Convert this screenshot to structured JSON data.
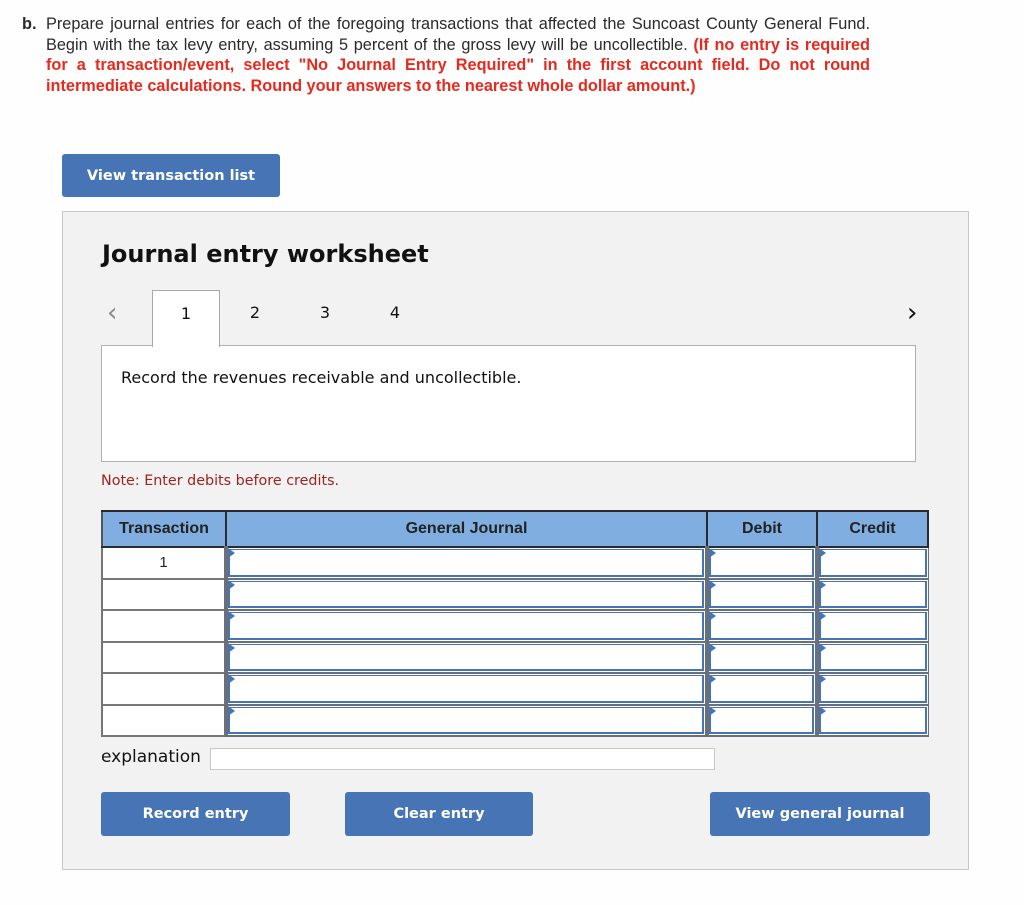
{
  "question": {
    "letter": "b.",
    "text": "Prepare journal entries for each of the foregoing transactions that affected the Suncoast County General Fund. Begin with the tax levy entry, assuming 5 percent of the gross levy will be uncollectible.",
    "instructions": "(If no entry is required for a transaction/event, select \"No Journal Entry Required\" in the first account field. Do not round intermediate calculations. Round your answers to the nearest whole dollar amount.)"
  },
  "buttons": {
    "view_transaction_list": "View transaction list",
    "record_entry": "Record entry",
    "clear_entry": "Clear entry",
    "view_general_journal": "View general journal"
  },
  "worksheet": {
    "title": "Journal entry worksheet",
    "nav": {
      "prev_icon": "‹",
      "next_icon": "›"
    },
    "tabs": [
      "1",
      "2",
      "3",
      "4"
    ],
    "active_tab": "1",
    "description": "Record the revenues receivable and uncollectible.",
    "note": "Note: Enter debits before credits.",
    "table": {
      "headers": [
        "Transaction",
        "General Journal",
        "Debit",
        "Credit"
      ],
      "rows": [
        {
          "transaction": "1",
          "account": "",
          "debit": "",
          "credit": ""
        },
        {
          "transaction": "",
          "account": "",
          "debit": "",
          "credit": ""
        },
        {
          "transaction": "",
          "account": "",
          "debit": "",
          "credit": ""
        },
        {
          "transaction": "",
          "account": "",
          "debit": "",
          "credit": ""
        },
        {
          "transaction": "",
          "account": "",
          "debit": "",
          "credit": ""
        },
        {
          "transaction": "",
          "account": "",
          "debit": "",
          "credit": ""
        }
      ]
    },
    "explanation_label": "explanation",
    "explanation_value": ""
  },
  "colors": {
    "button_blue": "#4674b4",
    "header_blue": "#80aee0",
    "instruction_red": "#e52a1f",
    "note_red": "#9e2220"
  }
}
